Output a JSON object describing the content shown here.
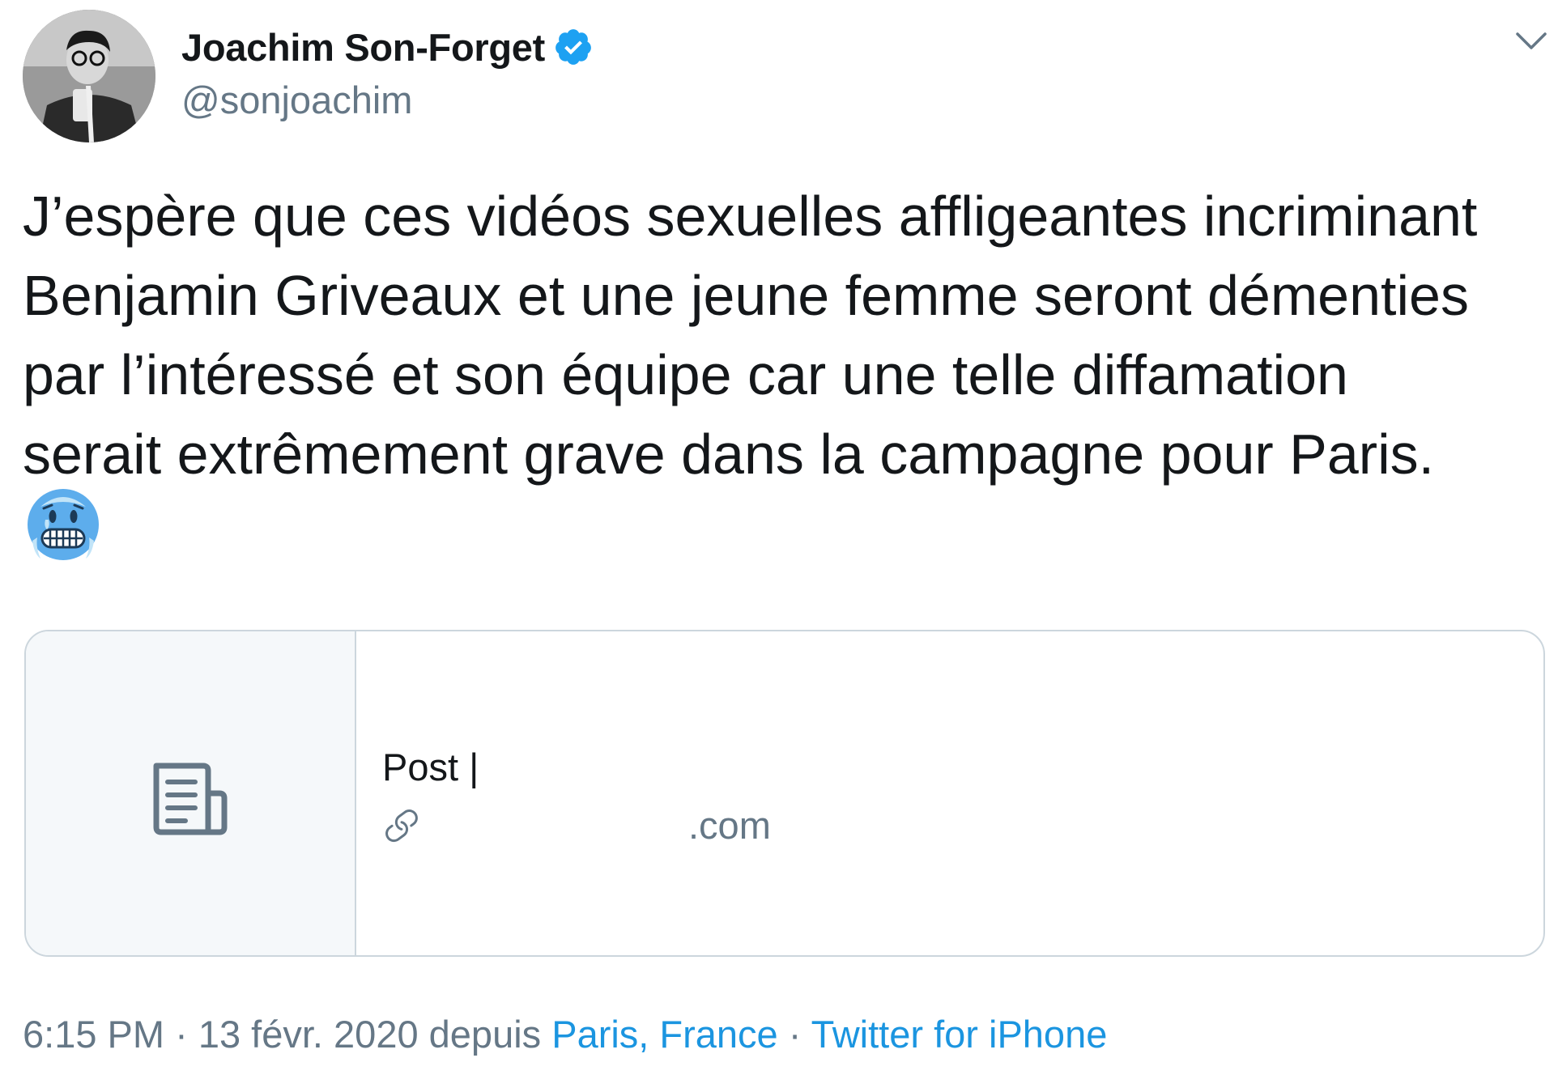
{
  "author": {
    "display_name": "Joachim Son-Forget",
    "handle": "@sonjoachim",
    "verified": true
  },
  "tweet": {
    "text": "J’espère que ces vidéos sexuelles affligeantes incriminant\nBenjamin Griveaux et une jeune femme seront démenties\npar l’intéressé et son équipe car une telle diffamation\nserait extrêmement grave dans la campagne pour Paris.",
    "emoji": "cold-face-emoji"
  },
  "card": {
    "title": "Post |",
    "domain": ".com",
    "thumbnail_icon": "document-icon",
    "link_icon": "link-icon"
  },
  "meta": {
    "time": "6:15 PM",
    "sep1": " · ",
    "date": "13 févr. 2020",
    "depuis": " depuis ",
    "location": "Paris, France",
    "sep2": " · ",
    "source": "Twitter for iPhone"
  },
  "colors": {
    "text": "#14171a",
    "secondary": "#657786",
    "link": "#1b95e0",
    "verified": "#1da1f2",
    "border": "#ccd6dd",
    "card_thumb_bg": "#f5f8fa"
  }
}
